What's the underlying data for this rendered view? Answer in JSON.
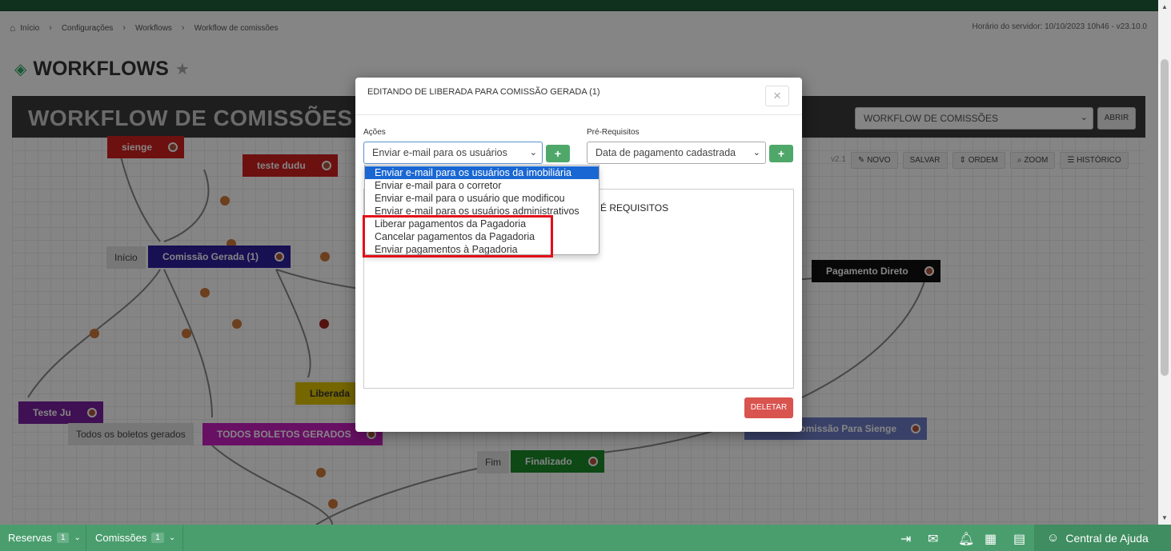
{
  "breadcrumb": {
    "home": "Início",
    "items": [
      "Configurações",
      "Workflows",
      "Workflow de comissões"
    ]
  },
  "server_time": "Horário do servidor: 10/10/2023 10h46 - v23.10.0",
  "page": {
    "title": "WORKFLOWS"
  },
  "workflow_bar": {
    "title": "WORKFLOW DE COMISSÕES",
    "select_value": "WORKFLOW DE COMISSÕES",
    "open_label": "ABRIR"
  },
  "toolbar": {
    "version": "v2.1",
    "novo": "NOVO",
    "salvar": "SALVAR",
    "ordem": "ORDEM",
    "zoom": "ZOOM",
    "historico": "HISTÓRICO"
  },
  "nodes": {
    "sienge": "sienge",
    "teste_dudu": "teste dudu",
    "inicio": "Início",
    "comissao_gerada": "Comissão Gerada (1)",
    "pagamento_direto": "Pagamento Direto",
    "liberada": "Liberada",
    "teste_ju": "Teste Ju",
    "todos_boletos_label": "Todos os boletos gerados",
    "todos_boletos": "TODOS BOLETOS GERADOS",
    "fim": "Fim",
    "finalizado": "Finalizado",
    "comissao_sienge": "omissão Para Sienge"
  },
  "modal": {
    "title": "EDITANDO DE LIBERADA PARA COMISSÃO GERADA (1)",
    "close": "×",
    "acoes_label": "Ações",
    "acoes_value": "Enviar e-mail para os usuários",
    "prereq_label": "Pré-Requisitos",
    "prereq_value": "Data de pagamento cadastrada",
    "plus": "+",
    "panel_heading": "É REQUISITOS",
    "delete": "DELETAR"
  },
  "dropdown": [
    "Enviar e-mail para os usuários da imobiliária",
    "Enviar e-mail para o corretor",
    "Enviar e-mail para o usuário que modificou",
    "Enviar e-mail para os usuários administrativos",
    "Liberar pagamentos da Pagadoria",
    "Cancelar pagamentos da Pagadoria",
    "Enviar pagamentos à Pagadoria"
  ],
  "bottombar": {
    "reservas": "Reservas",
    "reservas_count": "1",
    "comissoes": "Comissões",
    "comissoes_count": "1",
    "help": "Central de Ajuda"
  },
  "colors": {
    "accent": "#4a9e6e",
    "highlight": "#e30f1a",
    "selected": "#1967d2",
    "delete": "#d9534f"
  }
}
